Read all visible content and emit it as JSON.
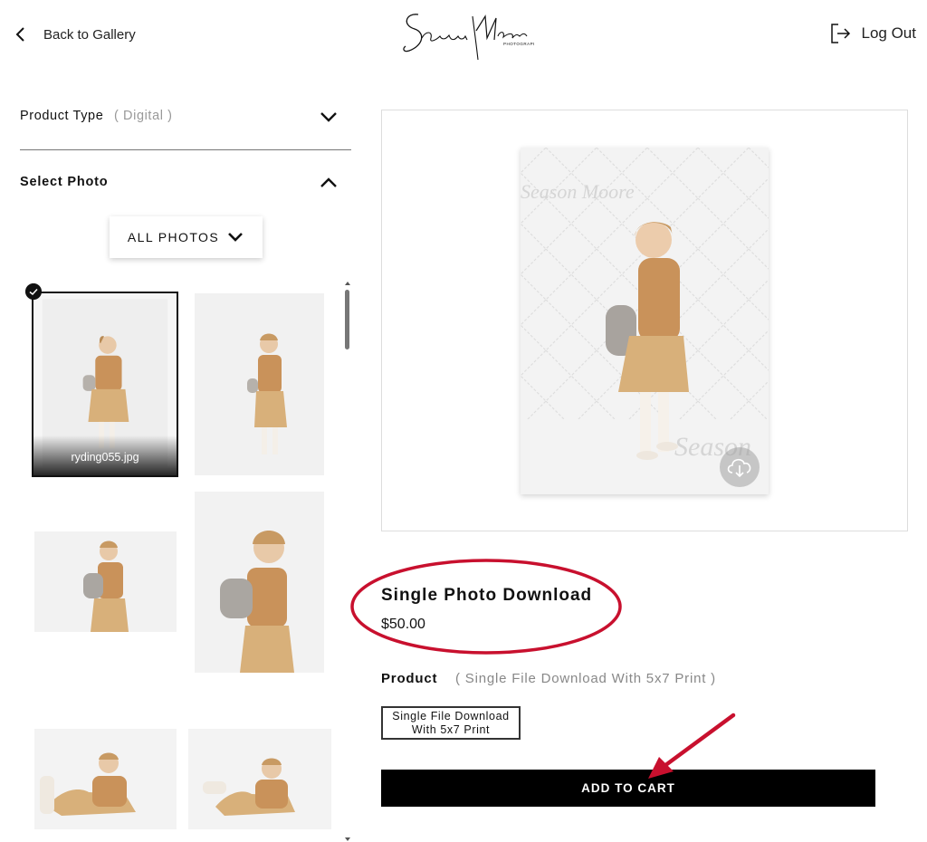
{
  "header": {
    "back_label": "Back to Gallery",
    "logout_label": "Log Out",
    "logo_text": "Season Moore",
    "logo_subtext": "PHOTOGRAPHY"
  },
  "sidebar": {
    "product_type_title": "Product Type",
    "product_type_value": "( Digital )",
    "select_photo_title": "Select Photo",
    "filter_label": "ALL PHOTOS",
    "selected_caption": "ryding055.jpg"
  },
  "main": {
    "product_name": "Single Photo Download",
    "product_price": "$50.00",
    "product_label": "Product",
    "product_value": "( Single File Download With 5x7 Print )",
    "option_label": "Single File Download With 5x7 Print",
    "add_to_cart_label": "ADD TO CART"
  },
  "colors": {
    "accent": "#000000",
    "annotation": "#c8102e",
    "muted": "#999999",
    "sweater": "#c9925a",
    "skirt": "#d8b07a"
  },
  "icons": [
    "chevron-left-icon",
    "logout-icon",
    "chevron-down-icon",
    "chevron-up-icon",
    "check-icon",
    "cloud-download-icon"
  ]
}
